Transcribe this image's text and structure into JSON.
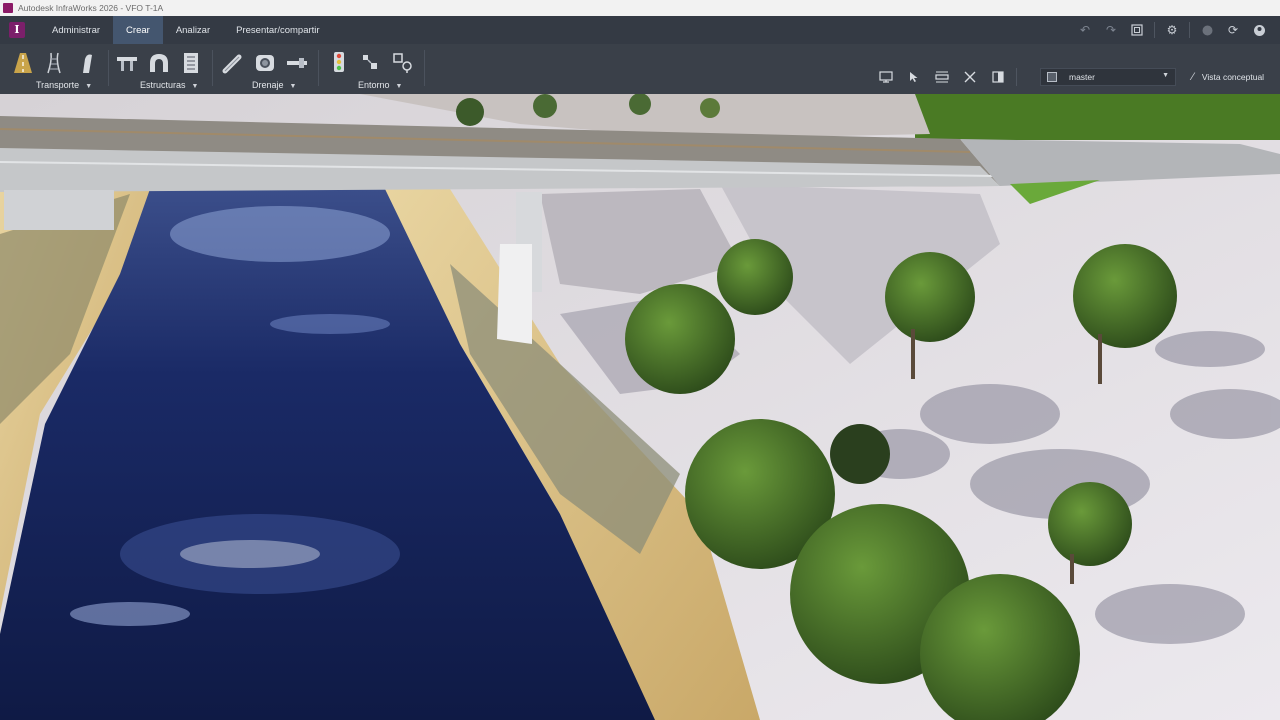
{
  "window": {
    "title": "Autodesk InfraWorks 2026 - VFO T-1A"
  },
  "menu": {
    "tabs": [
      {
        "label": "Administrar"
      },
      {
        "label": "Crear"
      },
      {
        "label": "Analizar"
      },
      {
        "label": "Presentar/compartir"
      }
    ],
    "active_tab": "Crear"
  },
  "ribbon": {
    "groups": [
      {
        "label": "Transporte",
        "icons": [
          "road-icon",
          "rail-icon",
          "road-asset-icon"
        ]
      },
      {
        "label": "Estructuras",
        "icons": [
          "bridge-icon",
          "tunnel-icon",
          "building-icon"
        ]
      },
      {
        "label": "Drenaje",
        "icons": [
          "pipeline-icon",
          "culvert-icon",
          "pipe-connector-icon"
        ]
      },
      {
        "label": "Entorno",
        "icons": [
          "traffic-light-icon",
          "city-furniture-icon",
          "tree-icon"
        ]
      }
    ]
  },
  "proposal": {
    "value": "master"
  },
  "view": {
    "style_label": "Vista conceptual"
  },
  "colors": {
    "accent_tab": "#44566f",
    "app_brand": "#7b1f6a",
    "water": "#14204f",
    "sand": "#d9c08a",
    "grass": "#4a7a24"
  }
}
